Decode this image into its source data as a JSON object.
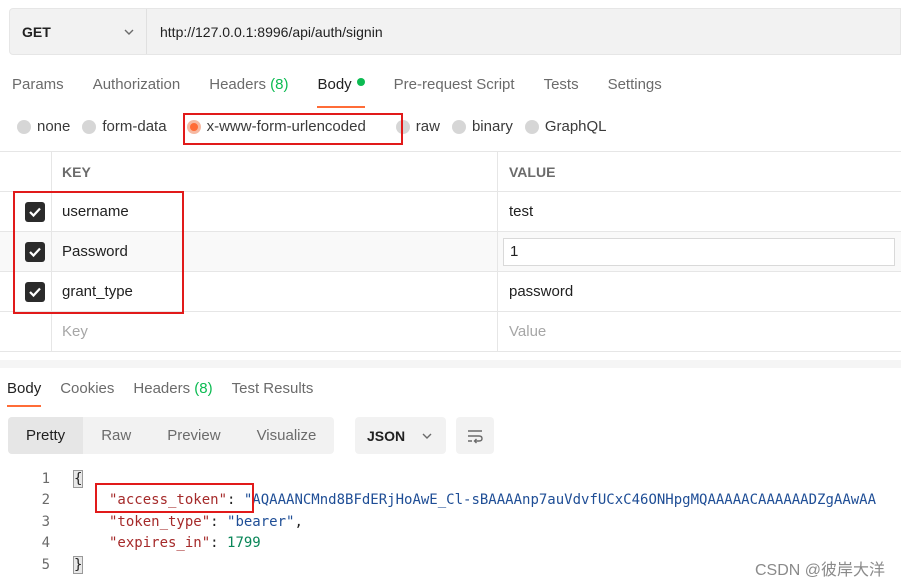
{
  "request": {
    "method": "GET",
    "url": "http://127.0.0.1:8996/api/auth/signin"
  },
  "req_tabs": [
    {
      "label": "Params",
      "count": ""
    },
    {
      "label": "Authorization",
      "count": ""
    },
    {
      "label": "Headers",
      "count": "(8)"
    },
    {
      "label": "Body",
      "count": ""
    },
    {
      "label": "Pre-request Script",
      "count": ""
    },
    {
      "label": "Tests",
      "count": ""
    },
    {
      "label": "Settings",
      "count": ""
    }
  ],
  "body_types": [
    "none",
    "form-data",
    "x-www-form-urlencoded",
    "raw",
    "binary",
    "GraphQL"
  ],
  "body_type_selected": "x-www-form-urlencoded",
  "params": {
    "header_key": "KEY",
    "header_value": "VALUE",
    "rows": [
      {
        "key": "username",
        "value": "test"
      },
      {
        "key": "Password",
        "value": "1"
      },
      {
        "key": "grant_type",
        "value": "password"
      }
    ],
    "placeholder_key": "Key",
    "placeholder_value": "Value"
  },
  "res_tabs": [
    {
      "label": "Body",
      "count": ""
    },
    {
      "label": "Cookies",
      "count": ""
    },
    {
      "label": "Headers",
      "count": "(8)"
    },
    {
      "label": "Test Results",
      "count": ""
    }
  ],
  "views": [
    "Pretty",
    "Raw",
    "Preview",
    "Visualize"
  ],
  "format": "JSON",
  "code": {
    "line_numbers": [
      "1",
      "2",
      "3",
      "4",
      "5"
    ],
    "open_brace": "{",
    "close_brace": "}",
    "access_token_key": "\"access_token\"",
    "access_token_value": "\"AQAAANCMnd8BFdERjHoAwE_Cl-sBAAAAnp7auVdvfUCxC46ONHpgMQAAAAACAAAAAADZgAAwAA",
    "token_type_key": "\"token_type\"",
    "token_type_value": "\"bearer\"",
    "expires_in_key": "\"expires_in\"",
    "expires_in_value": "1799"
  },
  "watermark": "CSDN @彼岸大洋",
  "colors": {
    "accent": "#ff6c37",
    "green": "#0cbb52",
    "highlight": "#e11a1a"
  }
}
